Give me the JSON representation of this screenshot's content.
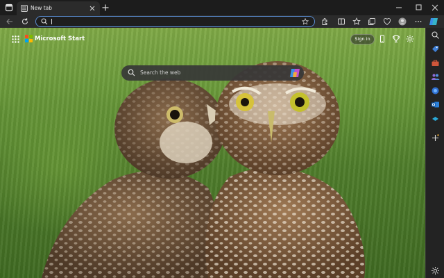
{
  "titlebar": {
    "tab_title": "New tab",
    "new_tab_icon": "plus-icon",
    "window_controls": [
      "minimize-icon",
      "restore-icon",
      "close-icon"
    ]
  },
  "toolbar": {
    "address_value": "",
    "address_placeholder": "",
    "icons": [
      "back-icon",
      "refresh-icon",
      "search-icon",
      "favorite-star-icon",
      "extensions-icon",
      "split-screen-icon",
      "favorites-icon",
      "collections-icon",
      "browser-essentials-icon",
      "profile-icon",
      "more-icon",
      "copilot-icon"
    ]
  },
  "content": {
    "brand": "Microsoft Start",
    "signin_label": "Sign in",
    "search_placeholder": "Search the web"
  },
  "sidebar": {
    "icons": [
      "search-icon",
      "tag-icon",
      "toolbox-icon",
      "people-icon",
      "m365-icon",
      "outlook-icon",
      "drop-icon",
      "add-icon",
      "settings-icon"
    ]
  },
  "colors": {
    "accent": "#5b8fd6",
    "titlebar": "#1c1c1c",
    "toolbar": "#2b2b2b"
  }
}
